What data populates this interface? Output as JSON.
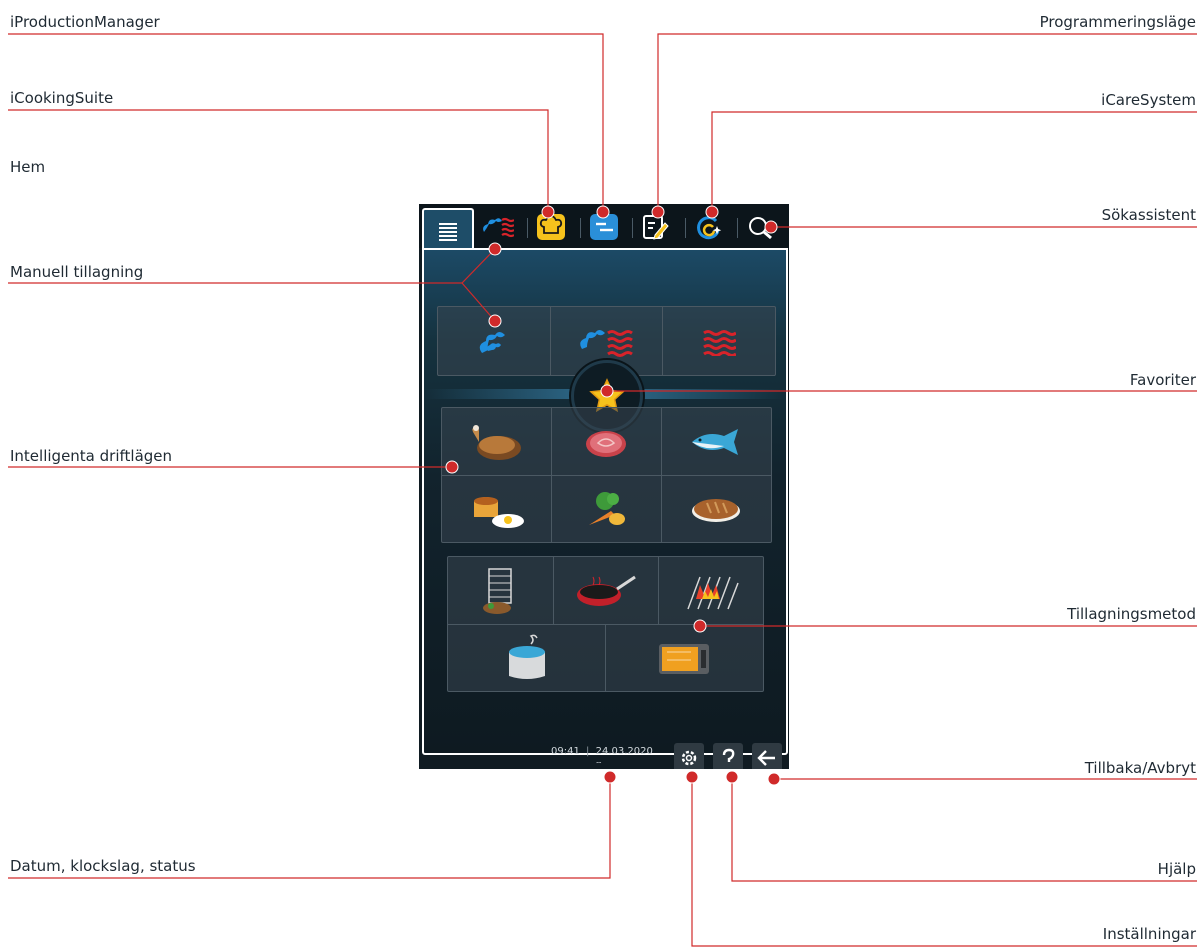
{
  "labels": {
    "iproductionmanager": "iProductionManager",
    "icookingsuite": "iCookingSuite",
    "hem": "Hem",
    "manuell_tillagning": "Manuell tillagning",
    "intelligenta_driftlagen": "Intelligenta driftlägen",
    "datum_klockslag_status": "Datum, klockslag, status",
    "programmeringslage": "Programmeringsläge",
    "icaresystem": "iCareSystem",
    "sokassistent": "Sökassistent",
    "favoriter": "Favoriter",
    "tillagningsmetod": "Tillagningsmetod",
    "tillbaka_avbryt": "Tillbaka/Avbryt",
    "hjalp": "Hjälp",
    "installningar": "Inställningar"
  },
  "screen": {
    "time": "09:41",
    "date": "24.03.2020"
  },
  "colors": {
    "leader": "#d02a2a",
    "steam": "#1f8fe0",
    "heat": "#d8232a",
    "accent_yellow": "#f6c21c",
    "accent_blue": "#2a8fd8"
  },
  "icons": {
    "tabs": [
      "menu-icon",
      "steam-convection-icon",
      "chef-hat-icon",
      "production-list-icon",
      "pencil-notepad-icon",
      "care-system-icon",
      "search-icon"
    ],
    "manual": [
      "steam-icon",
      "combi-steam-icon",
      "convection-heat-icon"
    ],
    "modes": [
      "poultry-icon",
      "meat-icon",
      "fish-icon",
      "egg-dessert-icon",
      "vegetables-icon",
      "bread-icon"
    ],
    "methods": [
      "rack-food-icon",
      "pan-frying-icon",
      "grilling-icon",
      "pot-boiling-icon",
      "oven-holding-icon"
    ],
    "status": [
      "settings-icon",
      "help-icon",
      "back-icon"
    ]
  }
}
